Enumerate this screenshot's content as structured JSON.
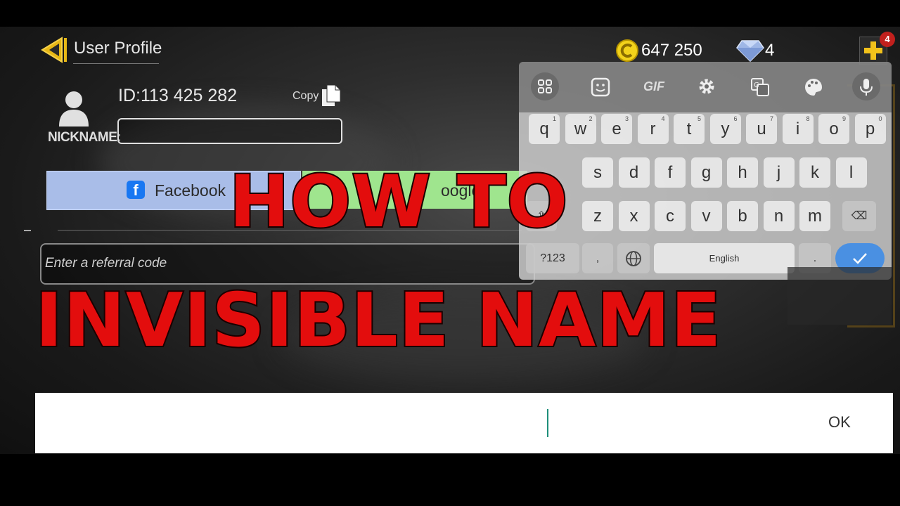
{
  "header": {
    "title": "User Profile"
  },
  "currency": {
    "coins": "647 250",
    "gems": "4",
    "notification_count": "4"
  },
  "profile": {
    "id_text": "ID:113 425 282",
    "copy_label": "Copy",
    "nickname_label": "NICKNAME:",
    "nickname_value": ""
  },
  "link_buttons": {
    "facebook": "Facebook",
    "google": "oogle"
  },
  "referral": {
    "placeholder": "Enter a referral code"
  },
  "keyboard": {
    "toolbar": {
      "gif": "GIF"
    },
    "row1": [
      "q",
      "w",
      "e",
      "r",
      "t",
      "y",
      "u",
      "i",
      "o",
      "p"
    ],
    "row1_hints": [
      "1",
      "2",
      "3",
      "4",
      "5",
      "6",
      "7",
      "8",
      "9",
      "0"
    ],
    "row2": [
      "s",
      "d",
      "f",
      "g",
      "h",
      "j",
      "k",
      "l"
    ],
    "row3": [
      "z",
      "x",
      "c",
      "v",
      "b",
      "n",
      "m"
    ],
    "symbols_key": "?123",
    "comma_key": ",",
    "period_key": ".",
    "space_label": "English"
  },
  "overlay": {
    "line1": "HOW TO",
    "line2": "INVISIBLE NAME"
  },
  "dialog": {
    "ok_label": "OK",
    "input_value": ""
  }
}
